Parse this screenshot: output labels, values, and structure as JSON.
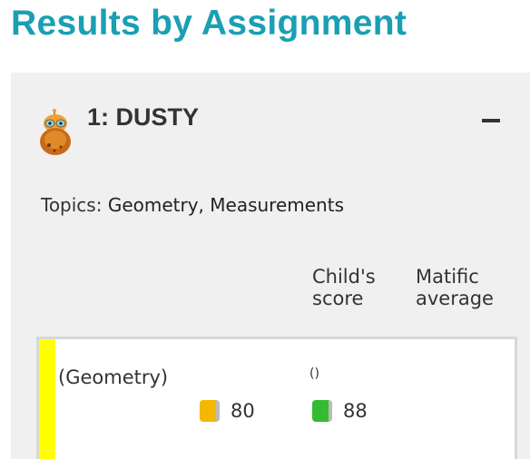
{
  "header": {
    "title": "Results by Assignment"
  },
  "assignment": {
    "title": "1: DUSTY",
    "avatar_icon": "dusty-character-icon",
    "collapse_icon": "minus-icon",
    "topics_label": "Topics:",
    "topics_values": "Geometry, Measurements",
    "columns": {
      "child_score": "Child's score",
      "average": "Matific average"
    },
    "rows": [
      {
        "name": "(Geometry)",
        "note": "()",
        "marker_color": "#ffff00",
        "child_score": "80",
        "child_color": "#f5b800",
        "average": "88",
        "average_color": "#33bb33"
      }
    ]
  }
}
